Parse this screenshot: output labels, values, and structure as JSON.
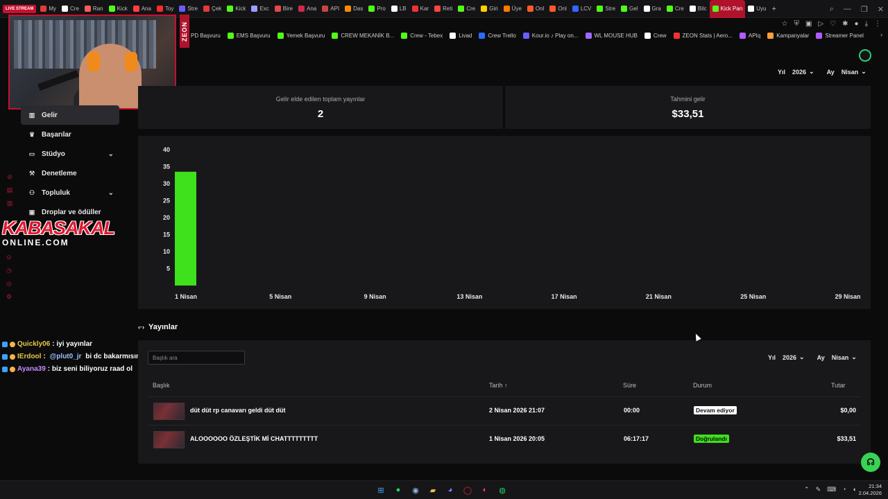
{
  "browser": {
    "live_badge": "LIVE STREAM",
    "tabs": [
      {
        "label": "My",
        "color": "#e03c3c"
      },
      {
        "label": "Cre",
        "color": "#ffffff"
      },
      {
        "label": "Ran",
        "color": "#ff5a5a"
      },
      {
        "label": "Kick",
        "color": "#53fc18"
      },
      {
        "label": "Ana",
        "color": "#ff4040"
      },
      {
        "label": "Toy",
        "color": "#ff2a2a"
      },
      {
        "label": "Stre",
        "color": "#6a5cff"
      },
      {
        "label": "Çek",
        "color": "#e23a3a"
      },
      {
        "label": "Kick",
        "color": "#53fc18"
      },
      {
        "label": "Exc",
        "color": "#9aa0ff"
      },
      {
        "label": "Bire",
        "color": "#e54848"
      },
      {
        "label": "Ana",
        "color": "#cc2a4a"
      },
      {
        "label": "API",
        "color": "#c44"
      },
      {
        "label": "Das",
        "color": "#ff8a00"
      },
      {
        "label": "Pro",
        "color": "#53fc18"
      },
      {
        "label": "LB",
        "color": "#ffffff"
      },
      {
        "label": "Kar",
        "color": "#e33"
      },
      {
        "label": "Reti",
        "color": "#ff4444"
      },
      {
        "label": "Cre",
        "color": "#53fc18"
      },
      {
        "label": "Giri",
        "color": "#ffd000"
      },
      {
        "label": "Üye",
        "color": "#ff7a00"
      },
      {
        "label": "Onl",
        "color": "#ff5a2a"
      },
      {
        "label": "Onl",
        "color": "#ff5a2a"
      },
      {
        "label": "LCV",
        "color": "#3366ff"
      },
      {
        "label": "Stre",
        "color": "#53fc18"
      },
      {
        "label": "Gel",
        "color": "#53fc18"
      },
      {
        "label": "Gra",
        "color": "#ffffff"
      },
      {
        "label": "Cre",
        "color": "#53fc18"
      },
      {
        "label": "Bilc",
        "color": "#ffffff"
      },
      {
        "label": "Kick Pan",
        "color": "#53fc18"
      },
      {
        "label": "Uyu",
        "color": "#ffffff"
      }
    ],
    "new_tab": "+"
  },
  "bookmarks": [
    {
      "label": "PD Başvuru",
      "color": "#53fc18"
    },
    {
      "label": "EMS Başvuru",
      "color": "#53fc18"
    },
    {
      "label": "Yemek Başvuru",
      "color": "#53fc18"
    },
    {
      "label": "CREW MEKANİK B...",
      "color": "#53fc18"
    },
    {
      "label": "Crew - Tebex",
      "color": "#53fc18"
    },
    {
      "label": "Livad",
      "color": "#ffffff"
    },
    {
      "label": "Crew Trello",
      "color": "#2a6cff"
    },
    {
      "label": "Kour.io ♪ Play on...",
      "color": "#6a5cff"
    },
    {
      "label": "WL MOUSE HUB",
      "color": "#9b6bff"
    },
    {
      "label": "Crew",
      "color": "#ffffff"
    },
    {
      "label": "ZEON Stats | Aero...",
      "color": "#e33"
    },
    {
      "label": "APIq",
      "color": "#b05cff"
    },
    {
      "label": "Kampanyalar",
      "color": "#ff9d3a"
    },
    {
      "label": "Streamer Panel",
      "color": "#b05cff"
    }
  ],
  "overlay": {
    "zeon_label": "ZEON",
    "kabasakal": "KABASAKAL",
    "kabasakal_sub": "ONLINE.COM"
  },
  "sidebar": {
    "items": [
      {
        "label": "Gelir",
        "icon": "chart-icon",
        "active": true
      },
      {
        "label": "Başarılar",
        "icon": "trophy-icon"
      },
      {
        "label": "Stüdyo",
        "icon": "studio-icon",
        "expandable": true
      },
      {
        "label": "Denetleme",
        "icon": "wrench-icon"
      },
      {
        "label": "Topluluk",
        "icon": "community-icon",
        "expandable": true
      },
      {
        "label": "Droplar ve ödüller",
        "icon": "gift-icon"
      }
    ]
  },
  "chat": [
    {
      "user": "Quickly06",
      "user_color": "#e5c84a",
      "text": ": iyi yayınlar"
    },
    {
      "user": "IErdool",
      "user_color": "#e5c84a",
      "text": ": ",
      "mention": "@plut0_jr",
      "rest": " bi dc bakarmısın cano"
    },
    {
      "user": "Ayana39",
      "user_color": "#c58bff",
      "text": ": biz seni biliyoruz raad ol"
    }
  ],
  "filters": {
    "year_label": "Yıl",
    "year_value": "2026",
    "month_label": "Ay",
    "month_value": "Nisan"
  },
  "stats": {
    "streams_label": "Gelir elde edilen toplam yayınlar",
    "streams_value": "2",
    "revenue_label": "Tahmini gelir",
    "revenue_value": "$33,51"
  },
  "chart_data": {
    "type": "bar",
    "x_labels": [
      "1 Nisan",
      "5 Nisan",
      "9 Nisan",
      "13 Nisan",
      "17 Nisan",
      "21 Nisan",
      "25 Nisan",
      "29 Nisan"
    ],
    "bars": [
      {
        "x": "1 Nisan",
        "value": 33.51
      }
    ],
    "y_ticks": [
      5,
      10,
      15,
      20,
      25,
      30,
      35,
      40
    ],
    "ylim": [
      0,
      40
    ],
    "bar_color": "#3fe01c"
  },
  "streams": {
    "title": "Yayınlar",
    "search_placeholder": "Başlık ara",
    "year_label": "Yıl",
    "year_value": "2026",
    "month_label": "Ay",
    "month_value": "Nisan",
    "columns": {
      "title": "Başlık",
      "date": "Tarih ↑",
      "duration": "Süre",
      "status": "Durum",
      "amount": "Tutar"
    },
    "rows": [
      {
        "title": "düt düt rp canavarı geldi düt düt",
        "date": "2 Nisan 2026 21:07",
        "duration": "00:00",
        "status": "Devam ediyor",
        "status_bg": "#ffffff",
        "status_fg": "#111111",
        "amount": "$0,00"
      },
      {
        "title": "ALOOOOOO ÖZLEŞTİK Mİ CHATTTTTTTTT",
        "date": "1 Nisan 2026 20:05",
        "duration": "06:17:17",
        "status": "Doğrulandı",
        "status_bg": "#3fe01c",
        "status_fg": "#0b0b0c",
        "amount": "$33,51"
      }
    ]
  },
  "taskbar": {
    "time": "21:34",
    "date": "2.04.2026"
  }
}
